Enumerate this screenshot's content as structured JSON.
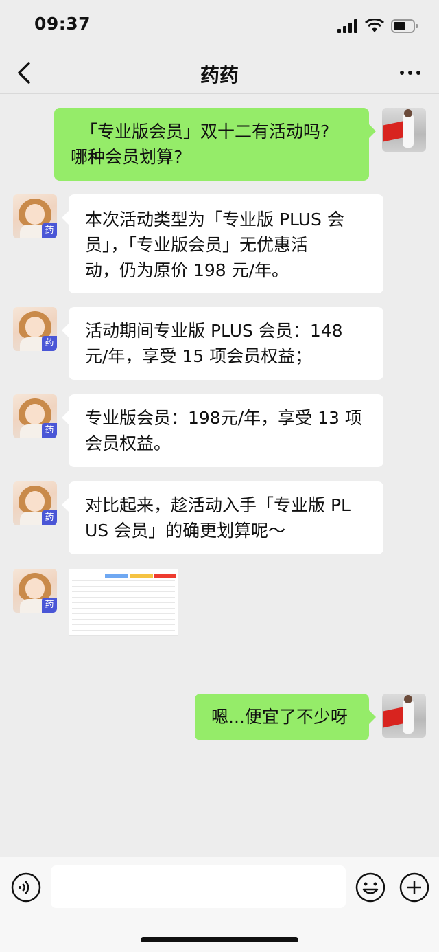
{
  "status_bar": {
    "time": "09:37"
  },
  "nav": {
    "title": "药药"
  },
  "messages": [
    {
      "side": "right",
      "text_lines": [
        "「专业版会员」双十二有活动吗?",
        "哪种会员划算?"
      ]
    },
    {
      "side": "left",
      "text_lines": [
        "本次活动类型为「专业版 PLUS 会",
        "员」，「专业版会员」无优惠活",
        "动，仍为原价 198 元/年。"
      ]
    },
    {
      "side": "left",
      "text_lines": [
        "活动期间专业版 PLUS 会员：148",
        "元/年，享受 15 项会员权益；"
      ]
    },
    {
      "side": "left",
      "text_lines": [
        "专业版会员：198元/年，享受 13 项",
        "会员权益。"
      ]
    },
    {
      "side": "left",
      "text_lines": [
        "对比起来，趁活动入手「专业版 PL",
        "US 会员」的确更划算呢～"
      ]
    },
    {
      "side": "left",
      "type": "image",
      "image_desc_icon": "membership-comparison-table-image"
    },
    {
      "side": "right",
      "text_lines": [
        "嗯...便宜了不少呀"
      ]
    }
  ],
  "avatar_badge": "药",
  "colors": {
    "accent": "#95ec69",
    "background": "#ededed",
    "badge": "#4a56d6"
  },
  "icons": [
    "back-icon",
    "more-icon",
    "voice-icon",
    "emoji-icon",
    "plus-icon",
    "signal-icon",
    "wifi-icon",
    "battery-icon"
  ]
}
